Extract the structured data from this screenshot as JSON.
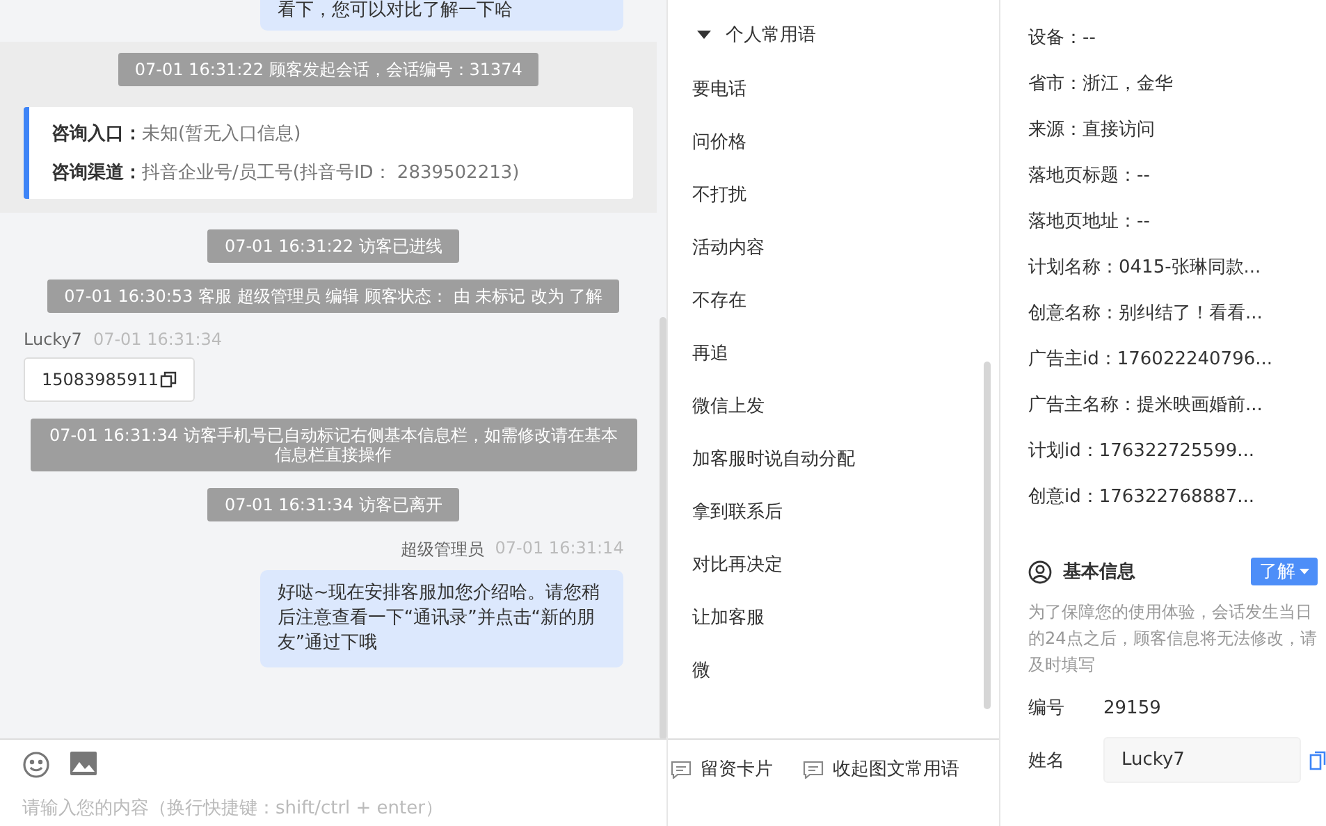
{
  "chat": {
    "top_bubble": "看下，您可以对比了解一下哈",
    "session": {
      "notice": "07-01 16:31:22 顾客发起会话，会话编号：31374",
      "rows": [
        {
          "label": "咨询入口：",
          "value": "未知(暂无入口信息)"
        },
        {
          "label": "咨询渠道：",
          "value": "抖音企业号/员工号(抖音号ID： 2839502213)"
        }
      ]
    },
    "items": [
      {
        "kind": "notice",
        "text": "07-01 16:31:22 访客已进线"
      },
      {
        "kind": "notice",
        "text": "07-01 16:30:53 客服 超级管理员 编辑 顾客状态： 由 未标记 改为 了解"
      },
      {
        "kind": "visitor",
        "name": "Lucky7",
        "time": "07-01 16:31:34",
        "text": "15083985911"
      },
      {
        "kind": "notice",
        "text": "07-01 16:31:34 访客手机号已自动标记右侧基本信息栏，如需修改请在基本信息栏直接操作"
      },
      {
        "kind": "notice",
        "text": "07-01 16:31:34 访客已离开"
      },
      {
        "kind": "agent",
        "name": "超级管理员",
        "time": "07-01 16:31:14",
        "text": "好哒~现在安排客服加您介绍哈。请您稍后注意查看一下“通讯录”并点击“新的朋友”通过下哦"
      }
    ],
    "input": {
      "placeholder": "请输入您的内容（换行快捷键：shift/ctrl + enter）"
    }
  },
  "phrases": {
    "group": {
      "title": "个人常用语",
      "expanded": true
    },
    "items": [
      "要电话",
      "问价格",
      "不打扰",
      "活动内容",
      "不存在",
      "再追",
      "微信上发",
      "加客服时说自动分配",
      "拿到联系后",
      "对比再决定",
      "让加客服",
      "微"
    ],
    "actions": [
      "留资卡片",
      "收起图文常用语"
    ]
  },
  "info": {
    "fields": [
      "设备：--",
      "省市：浙江，金华",
      "来源：直接访问",
      "落地页标题：--",
      "落地页地址：--",
      "计划名称：0415-张琳同款...",
      "创意名称：别纠结了！看看...",
      "广告主id：176022240796...",
      "广告主名称：提米映画婚前...",
      "计划id：176322725599...",
      "创意id：176322768887..."
    ],
    "basic": {
      "title": "基本信息",
      "status": "了解",
      "hint": "为了保障您的使用体验，会话发生当日的24点之后，顾客信息将无法修改，请及时填写",
      "rows": [
        {
          "kind": "text",
          "label": "编号",
          "value": "29159"
        },
        {
          "kind": "input",
          "label": "姓名",
          "value": "Lucky7"
        }
      ]
    }
  }
}
